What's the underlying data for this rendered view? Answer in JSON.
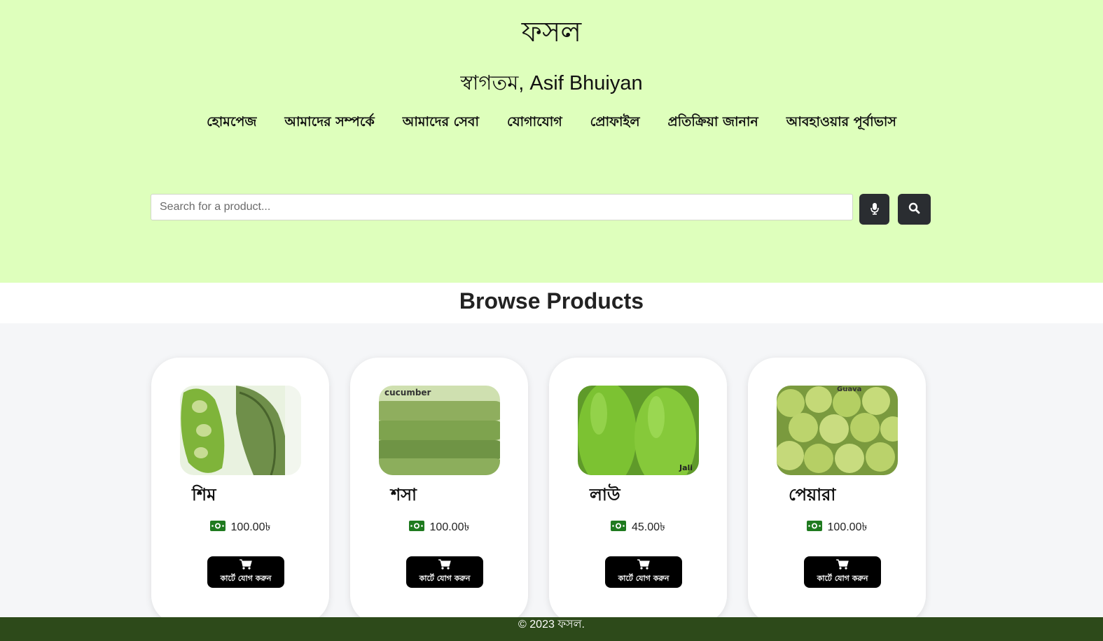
{
  "header": {
    "site_title": "ফসল",
    "welcome": "স্বাগতম, Asif Bhuiyan",
    "nav": [
      {
        "label": "হোমপেজ"
      },
      {
        "label": "আমাদের সম্পর্কে"
      },
      {
        "label": "আমাদের সেবা"
      },
      {
        "label": "যোগাযোগ"
      },
      {
        "label": "প্রোফাইল"
      },
      {
        "label": "প্রতিক্রিয়া জানান"
      },
      {
        "label": "আবহাওয়ার পূর্বাভাস"
      }
    ],
    "search": {
      "placeholder": "Search for a product...",
      "value": ""
    },
    "icons": {
      "mic": "microphone-icon",
      "search": "search-icon"
    }
  },
  "browse": {
    "title": "Browse Products"
  },
  "products": [
    {
      "name": "শিম",
      "price": "100.00৳",
      "button": "কার্টে যোগ করুন",
      "image_label": ""
    },
    {
      "name": "শসা",
      "price": "100.00৳",
      "button": "কার্টে যোগ করুন",
      "image_label": "cucumber"
    },
    {
      "name": "লাউ",
      "price": "45.00৳",
      "button": "কার্টে যোগ করুন",
      "image_label": "Jali"
    },
    {
      "name": "পেয়ারা",
      "price": "100.00৳",
      "button": "কার্টে যোগ করুন",
      "image_label": "Guava"
    }
  ],
  "footer": {
    "text": "© 2023 ফসল."
  },
  "colors": {
    "header_bg": "#deffbc",
    "footer_bg": "#2d4a1a",
    "button_bg": "#000000",
    "icon_btn_bg": "#2a2d31",
    "money_icon": "#1f7a1f"
  }
}
